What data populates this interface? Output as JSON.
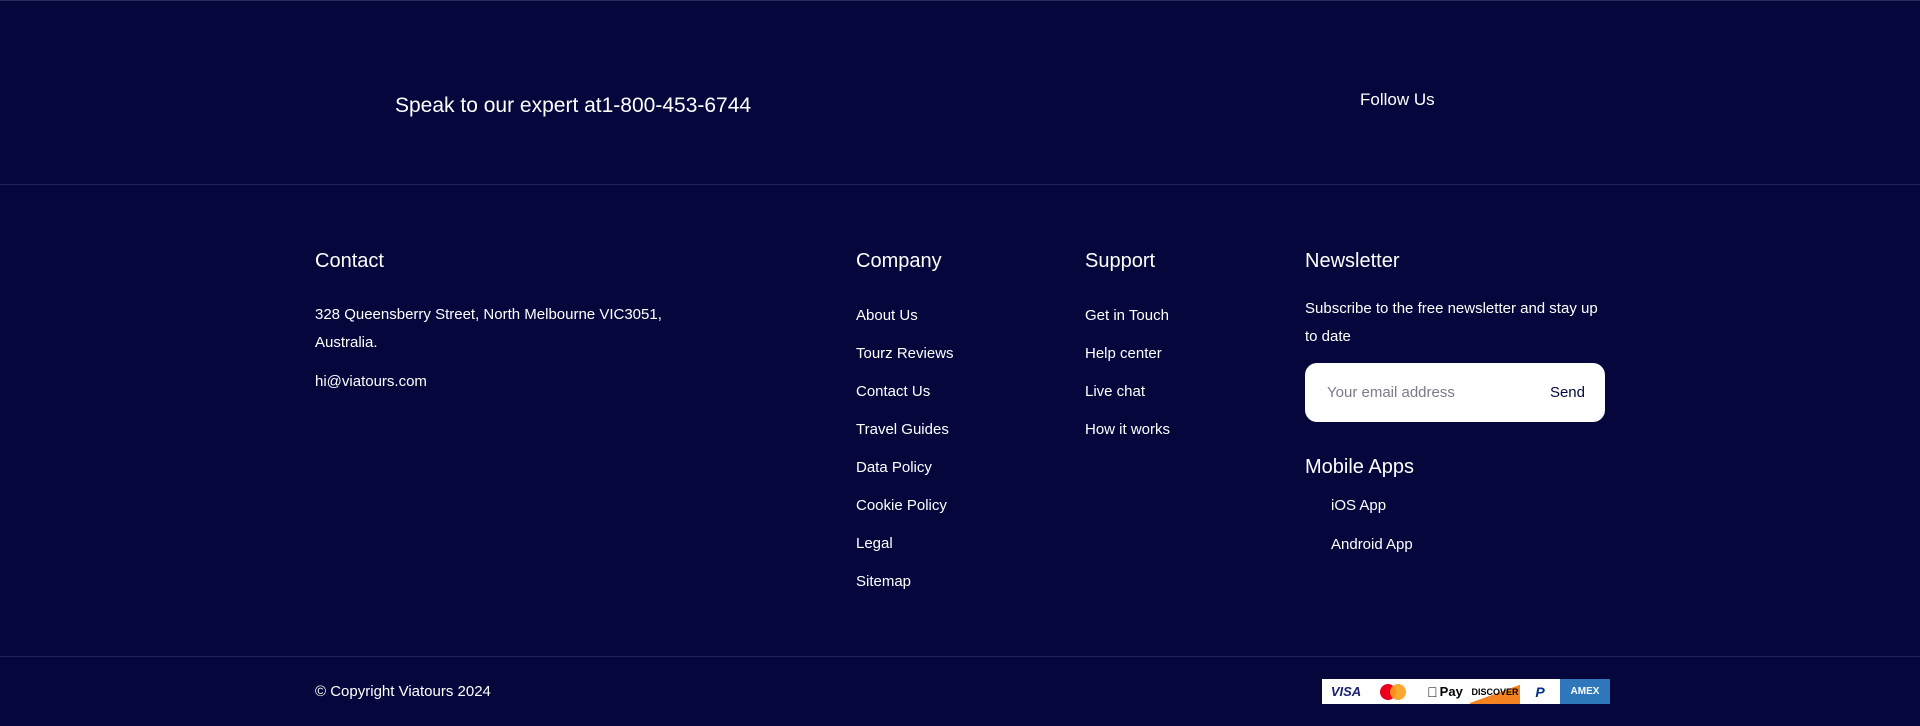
{
  "top": {
    "expert_text": "Speak to our expert at1-800-453-6744",
    "follow_label": "Follow Us"
  },
  "contact": {
    "title": "Contact",
    "address": "328 Queensberry Street, North Melbourne VIC3051, Australia.",
    "email": "hi@viatours.com"
  },
  "company": {
    "title": "Company",
    "links": [
      "About Us",
      "Tourz Reviews",
      "Contact Us",
      "Travel Guides",
      "Data Policy",
      "Cookie Policy",
      "Legal",
      "Sitemap"
    ]
  },
  "support": {
    "title": "Support",
    "links": [
      "Get in Touch",
      "Help center",
      "Live chat",
      "How it works"
    ]
  },
  "newsletter": {
    "title": "Newsletter",
    "description": "Subscribe to the free newsletter and stay up to date",
    "placeholder": "Your email address",
    "send_label": "Send"
  },
  "mobile_apps": {
    "title": "Mobile Apps",
    "ios_label": "iOS App",
    "android_label": "Android App"
  },
  "footer": {
    "copyright": "© Copyright Viatours 2024",
    "payments": {
      "visa": "VISA",
      "applepay": "Pay",
      "discover": "DISCOVER",
      "paypal": "P",
      "amex": "AMEX"
    }
  }
}
